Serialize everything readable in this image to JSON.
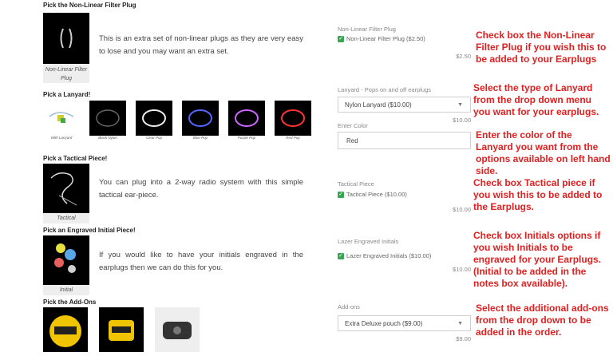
{
  "sections": {
    "filter_title": "Pick the Non-Linear Filter Plug",
    "filter_desc": "This is an extra set of non-linear plugs as they are very easy to lose and you may want an extra set.",
    "filter_caption": "Non-Linear Filter Plug",
    "lanyard_title": "Pick a Lanyard!",
    "lanyard_items": [
      "With Lanyard",
      "Black Nylon",
      "Clear Pop",
      "Blue Pop",
      "Purple Pop",
      "Red Pop"
    ],
    "tactical_title": "Pick a Tactical Piece!",
    "tactical_desc": "You can plug into a 2-way radio system with this simple tactical ear-piece.",
    "tactical_caption": "Tactical",
    "initial_title": "Pick an Engraved Initial Piece!",
    "initial_desc": "If you would like to have your initials engraved in the earplugs then we can do this for you.",
    "initial_caption": "Initial",
    "addons_title": "Pick the Add-Ons"
  },
  "form": {
    "filter_label": "Non-Linear Filter Plug",
    "filter_option": "Non-Linear Filter Plug ($2.50)",
    "filter_price": "$2.50",
    "lanyard_label": "Lanyard - Pops on and off earplugs",
    "lanyard_value": "Nylon Lanyard ($10.00)",
    "lanyard_price": "$10.00",
    "color_label": "Enter Color",
    "color_value": "Red",
    "tactical_label": "Tactical Piece",
    "tactical_option": "Tactical Piece ($10.00)",
    "tactical_price": "$10.00",
    "initials_label": "Lazer Engraved Initials",
    "initials_option": "Lazer Engraved Initials ($10.00)",
    "initials_price": "$10.00",
    "addons_label": "Add-ons",
    "addons_value": "Extra Deluxe pouch ($9.00)",
    "addons_price": "$9.00"
  },
  "notes": {
    "filter": "Check box the Non-Linear Filter Plug if you wish this to be added to your Earplugs",
    "lanyard": "Select the type of Lanyard from the drop down menu you want for your earplugs.",
    "color": "Enter the color of the Lanyard you want from the options available on left hand side.",
    "tactical": "Check box Tactical piece if you wish this to be added to the Earplugs.",
    "initials": "Check box Initials options if you wish Initials to be engraved for your Earplugs. (Initial to be added in the notes box available).",
    "addons": "Select the additional add-ons from the drop down to be added in the order."
  },
  "icons": {
    "check": "checkmark-icon",
    "dropdown": "chevron-down-icon"
  },
  "colors": {
    "note_red": "#e02020",
    "check_green": "#3aa655"
  }
}
